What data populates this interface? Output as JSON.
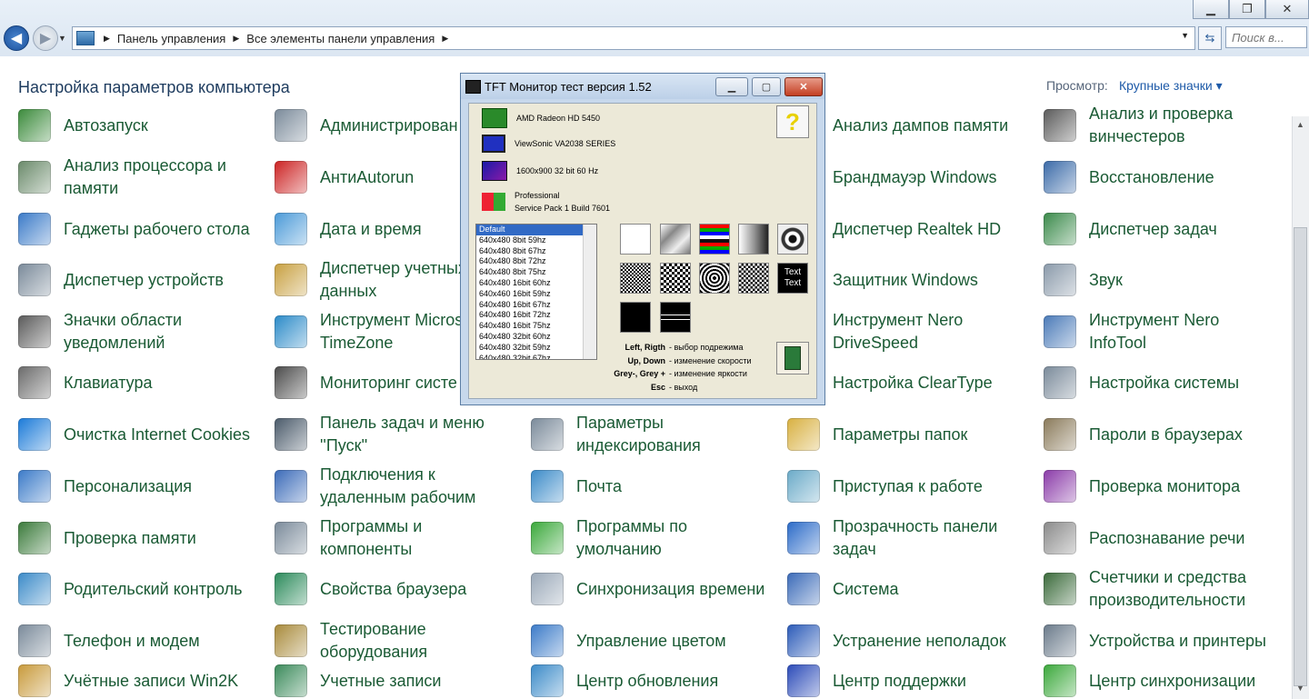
{
  "window": {
    "minimize": "▁",
    "maximize": "❐",
    "close": "✕"
  },
  "nav": {
    "breadcrumb": [
      "Панель управления",
      "Все элементы панели управления"
    ],
    "search_placeholder": "Поиск в..."
  },
  "header": {
    "title": "Настройка параметров компьютера",
    "view_label": "Просмотр:",
    "view_value": "Крупные значки ▾"
  },
  "items": [
    {
      "label": "Автозапуск",
      "icon": "autoplay-icon",
      "color": "#3a8a3a"
    },
    {
      "label": "Администрирован",
      "icon": "admin-tools-icon",
      "color": "#7a8a9a"
    },
    {
      "label": "",
      "icon": "",
      "color": ""
    },
    {
      "label": "Анализ дампов памяти",
      "icon": "memory-dump-icon",
      "color": "#6a6a6a"
    },
    {
      "label": "Анализ и проверка винчестеров",
      "icon": "hdd-check-icon",
      "color": "#5a5a5a"
    },
    {
      "label": "Анализ процессора и памяти",
      "icon": "cpu-icon",
      "color": "#6a8a6a"
    },
    {
      "label": "АнтиAutorun",
      "icon": "first-aid-icon",
      "color": "#cc2222"
    },
    {
      "label": "",
      "icon": "",
      "color": ""
    },
    {
      "label": "Брандмауэр Windows",
      "icon": "firewall-icon",
      "color": "#b05020"
    },
    {
      "label": "Восстановление",
      "icon": "recovery-icon",
      "color": "#3a6aa8"
    },
    {
      "label": "Гаджеты рабочего стола",
      "icon": "gadgets-icon",
      "color": "#3a7ac8"
    },
    {
      "label": "Дата и время",
      "icon": "calendar-icon",
      "color": "#4a9ad8"
    },
    {
      "label": "",
      "icon": "",
      "color": ""
    },
    {
      "label": "Диспетчер Realtek HD",
      "icon": "realtek-icon",
      "color": "#2a5aa8"
    },
    {
      "label": "Диспетчер задач",
      "icon": "task-manager-icon",
      "color": "#3a8a4a"
    },
    {
      "label": "Диспетчер устройств",
      "icon": "device-manager-icon",
      "color": "#7a8a9a"
    },
    {
      "label": "Диспетчер учетных данных",
      "icon": "credential-vault-icon",
      "color": "#c8a040"
    },
    {
      "label": "",
      "icon": "",
      "color": ""
    },
    {
      "label": "Защитник Windows",
      "icon": "defender-icon",
      "color": "#5a6a7a"
    },
    {
      "label": "Звук",
      "icon": "speaker-icon",
      "color": "#8a9aaa"
    },
    {
      "label": "Значки области уведомлений",
      "icon": "notification-icon",
      "color": "#5a5a5a"
    },
    {
      "label": "Инструмент Micros TimeZone",
      "icon": "globe-icon",
      "color": "#2a8ac8"
    },
    {
      "label": "",
      "icon": "",
      "color": ""
    },
    {
      "label": "Инструмент Nero DriveSpeed",
      "icon": "drivespeed-icon",
      "color": "#4a6a8a"
    },
    {
      "label": "Инструмент Nero InfoTool",
      "icon": "infotool-icon",
      "color": "#4a7ab8"
    },
    {
      "label": "Клавиатура",
      "icon": "keyboard-icon",
      "color": "#6a6a6a"
    },
    {
      "label": "Мониторинг систе",
      "icon": "gauge-icon",
      "color": "#4a4a4a"
    },
    {
      "label": "",
      "icon": "",
      "color": ""
    },
    {
      "label": "Настройка ClearType",
      "icon": "cleartype-icon",
      "color": "#3a6ab8"
    },
    {
      "label": "Настройка системы",
      "icon": "system-config-icon",
      "color": "#7a8a9a"
    },
    {
      "label": "Очистка Internet Cookies",
      "icon": "ie-icon",
      "color": "#1a7ad8"
    },
    {
      "label": "Панель задач и меню ''Пуск''",
      "icon": "taskbar-icon",
      "color": "#4a5a6a"
    },
    {
      "label": "Параметры индексирования",
      "icon": "indexing-icon",
      "color": "#7a8a9a"
    },
    {
      "label": "Параметры папок",
      "icon": "folder-options-icon",
      "color": "#d8b040"
    },
    {
      "label": "Пароли в браузерах",
      "icon": "keys-icon",
      "color": "#8a7a5a"
    },
    {
      "label": "Персонализация",
      "icon": "personalization-icon",
      "color": "#3a7ac8"
    },
    {
      "label": "Подключения к удаленным рабочим",
      "icon": "remote-desktop-icon",
      "color": "#3a6ab8"
    },
    {
      "label": "Почта",
      "icon": "mail-icon",
      "color": "#3a8ac8"
    },
    {
      "label": "Приступая к работе",
      "icon": "getting-started-icon",
      "color": "#6aaac8"
    },
    {
      "label": "Проверка монитора",
      "icon": "monitor-check-icon",
      "color": "#8a3aa8"
    },
    {
      "label": "Проверка памяти",
      "icon": "ram-icon",
      "color": "#3a7a3a"
    },
    {
      "label": "Программы и компоненты",
      "icon": "programs-icon",
      "color": "#7a8a9a"
    },
    {
      "label": "Программы по умолчанию",
      "icon": "default-programs-icon",
      "color": "#3aa83a"
    },
    {
      "label": "Прозрачность панели задач",
      "icon": "windows-flag-icon",
      "color": "#2a6ac8"
    },
    {
      "label": "Распознавание речи",
      "icon": "microphone-icon",
      "color": "#8a8a8a"
    },
    {
      "label": "Родительский контроль",
      "icon": "parental-icon",
      "color": "#3a8ac8"
    },
    {
      "label": "Свойства браузера",
      "icon": "browser-props-icon",
      "color": "#2a8a5a"
    },
    {
      "label": "Синхронизация времени",
      "icon": "clock-icon",
      "color": "#9aa8b8"
    },
    {
      "label": "Система",
      "icon": "system-icon",
      "color": "#3a6ab8"
    },
    {
      "label": "Счетчики и средства производительности",
      "icon": "performance-icon",
      "color": "#3a6a3a"
    },
    {
      "label": "Телефон и модем",
      "icon": "phone-icon",
      "color": "#7a8a9a"
    },
    {
      "label": "Тестирование оборудования",
      "icon": "hw-test-icon",
      "color": "#a88a3a"
    },
    {
      "label": "Управление цветом",
      "icon": "color-mgmt-icon",
      "color": "#3a7ac8"
    },
    {
      "label": "Устранение неполадок",
      "icon": "troubleshoot-icon",
      "color": "#2a5ab8"
    },
    {
      "label": "Устройства и принтеры",
      "icon": "printer-icon",
      "color": "#6a7a8a"
    },
    {
      "label": "Учётные записи Win2K",
      "icon": "lock-icon",
      "color": "#c89a3a"
    },
    {
      "label": "Учетные записи",
      "icon": "users-icon",
      "color": "#3a8a5a"
    },
    {
      "label": "Центр обновления",
      "icon": "update-icon",
      "color": "#3a8ac8"
    },
    {
      "label": "Центр поддержки",
      "icon": "action-center-flag-icon",
      "color": "#2a4ab8"
    },
    {
      "label": "Центр синхронизации",
      "icon": "sync-center-icon",
      "color": "#3aa83a"
    }
  ],
  "dialog": {
    "title": "TFT Монитор тест версия 1.52",
    "gpu": "AMD Radeon HD 5450",
    "monitor": "ViewSonic VA2038 SERIES",
    "resolution": "1600x900 32 bit 60 Hz",
    "os_line1": "Professional",
    "os_line2": "Service Pack 1 Build 7601",
    "help": "?",
    "modes": [
      "Default",
      "640x480  8bit  59hz",
      "640x480  8bit  67hz",
      "640x480  8bit  72hz",
      "640x480  8bit  75hz",
      "640x480  16bit  60hz",
      "640x460  16bit  59hz",
      "640x480  16bit  67hz",
      "640x480  16bit  72hz",
      "640x480  16bit  75hz",
      "640x480  32bit  60hz",
      "640x480  32bit  59hz",
      "640x480  32bit  67hz"
    ],
    "text_test": "Text Text",
    "keys": [
      {
        "key": "Left, Rigth",
        "desc": "- выбор подрежима"
      },
      {
        "key": "Up, Down",
        "desc": "- изменение скорости"
      },
      {
        "key": "Grey-, Grey +",
        "desc": "- изменение яркости"
      },
      {
        "key": "Esc",
        "desc": "- выход"
      }
    ]
  }
}
